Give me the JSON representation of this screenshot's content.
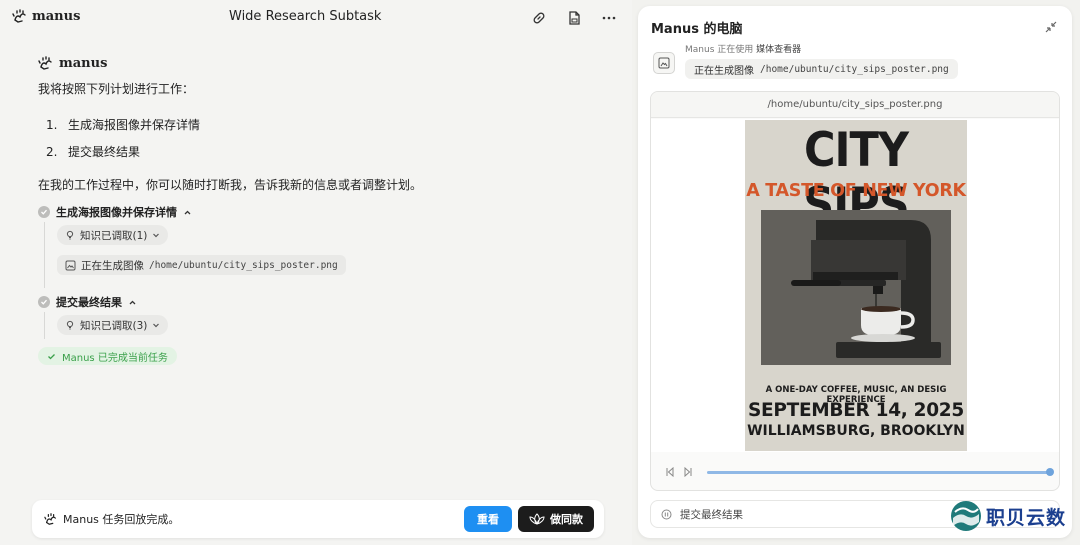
{
  "header": {
    "brand": "manus",
    "title": "Wide Research Subtask",
    "icons": [
      "link-icon",
      "file-icon",
      "more-icon"
    ]
  },
  "chat": {
    "brand": "manus",
    "intro": "我将按照下列计划进行工作：",
    "plan": [
      {
        "num": "1.",
        "text": "生成海报图像并保存详情"
      },
      {
        "num": "2.",
        "text": "提交最终结果"
      }
    ],
    "note": "在我的工作过程中，你可以随时打断我，告诉我新的信息或者调整计划。",
    "steps": [
      {
        "title": "生成海报图像并保存详情",
        "knowledge": "知识已调取(1)",
        "tool_label": "正在生成图像",
        "tool_path": "/home/ubuntu/city_sips_poster.png"
      },
      {
        "title": "提交最终结果",
        "knowledge": "知识已调取(3)"
      }
    ],
    "done": "Manus 已完成当前任务"
  },
  "bottombar": {
    "status": "Manus 任务回放完成。",
    "replay": "重看",
    "same": "做同款"
  },
  "computer": {
    "title": "Manus 的电脑",
    "using_prefix": "Manus 正在使用",
    "using_tool": "媒体查看器",
    "action_label": "正在生成图像",
    "action_path": "/home/ubuntu/city_sips_poster.png",
    "viewer_path": "/home/ubuntu/city_sips_poster.png",
    "progress": 1.0,
    "bottom_status": "提交最终结果"
  },
  "poster": {
    "title": "CITY SIPS",
    "subtitle": "A TASTE OF NEW YORK",
    "tagline": "A ONE-DAY COFFEE, MUSIC, AN DESIG EXPERIENCE",
    "date": "SEPTEMBER 14, 2025",
    "location": "WILLIAMSBURG, BROOKLYN"
  },
  "watermark": {
    "text": "职贝云数"
  },
  "colors": {
    "accent_blue": "#1e8ff2",
    "success_green": "#3aa04a",
    "poster_orange": "#d4572a"
  }
}
